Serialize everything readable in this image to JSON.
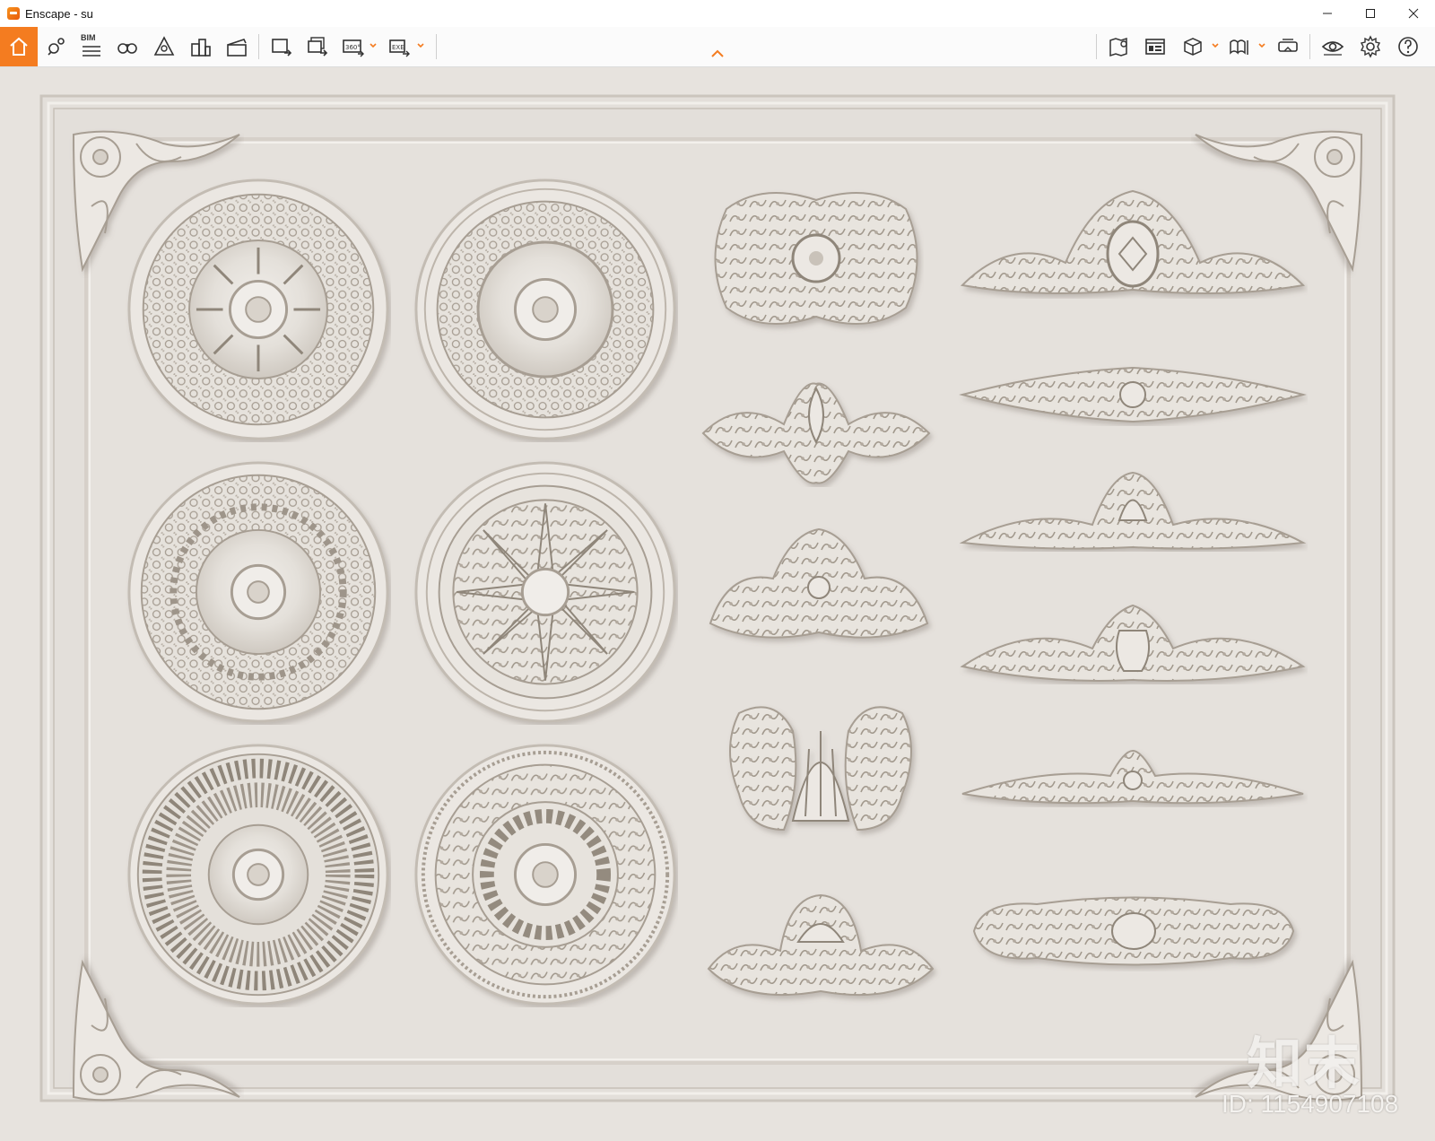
{
  "window": {
    "title": "Enscape - su",
    "controls": [
      "minimize",
      "maximize",
      "close"
    ]
  },
  "toolbar": {
    "home": "home-icon",
    "bim_label": "BIM",
    "left_tools": [
      "home-icon",
      "visual-settings-pin-icon",
      "bim-list-icon",
      "binoculars-icon",
      "asset-library-icon",
      "buildings-icon",
      "clapper-icon",
      "screenshot-export-icon",
      "batch-export-icon",
      "panorama-360-icon",
      "exe-export-icon"
    ],
    "right_tools": [
      "map-pin-icon",
      "view-management-icon",
      "cube-icon",
      "book-icon",
      "vr-headset-icon",
      "eye-icon",
      "gear-icon",
      "help-icon"
    ]
  },
  "watermark": {
    "logo": "知末",
    "id": "ID: 1154907108"
  }
}
